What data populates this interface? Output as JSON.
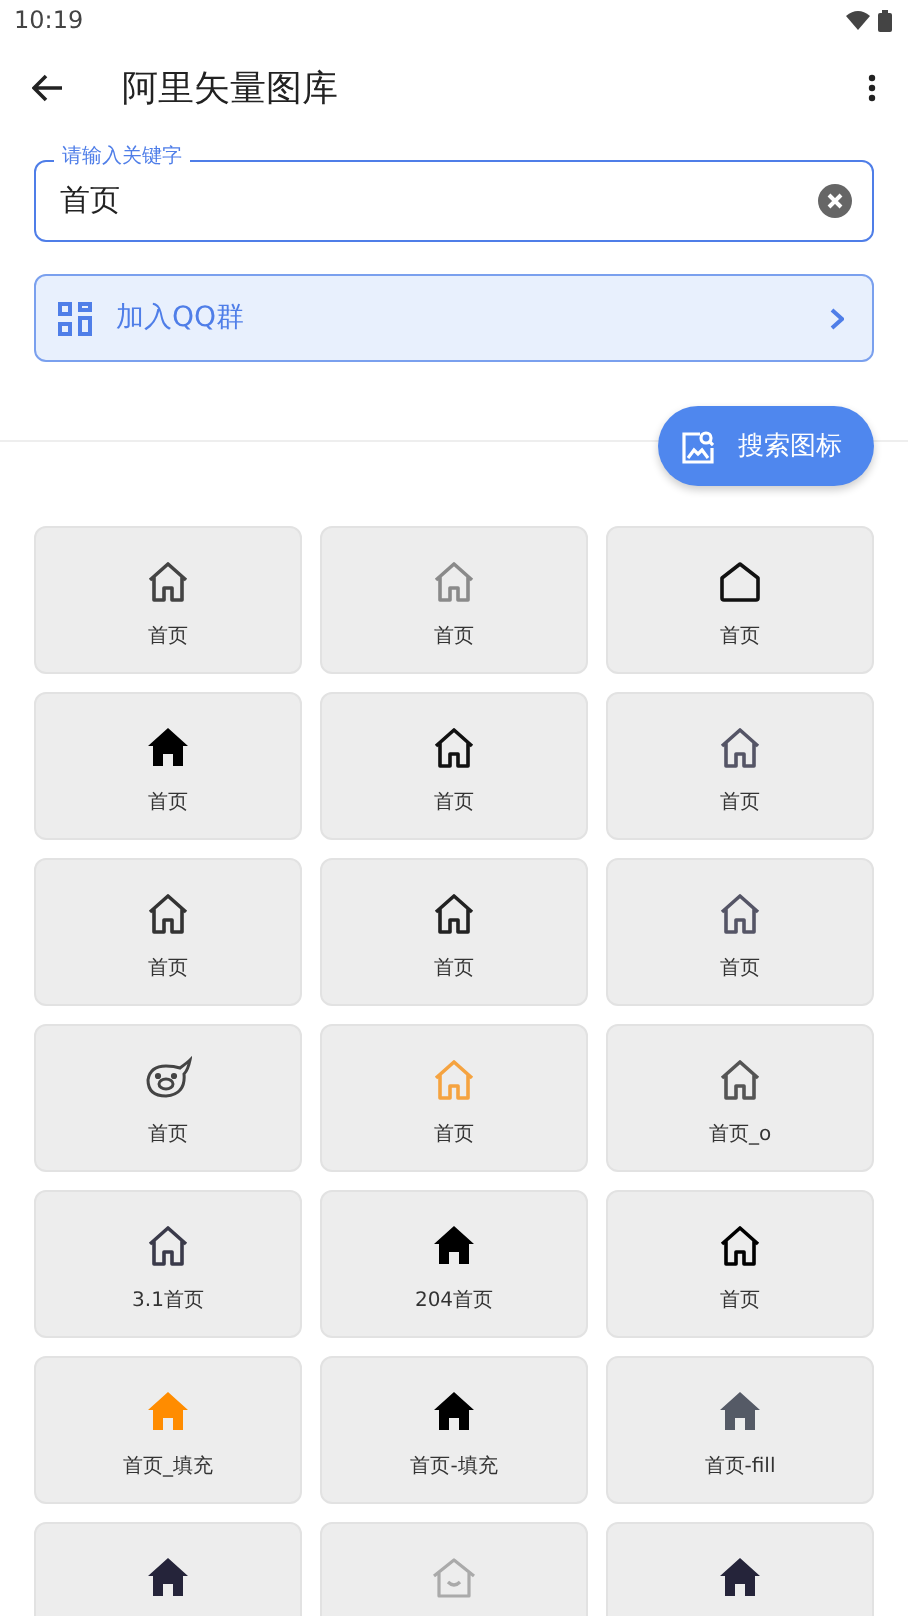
{
  "status_bar": {
    "time": "10:19"
  },
  "app_bar": {
    "title": "阿里矢量图库"
  },
  "search": {
    "label": "请输入关键字",
    "value": "首页"
  },
  "qq_banner": {
    "label": "加入QQ群"
  },
  "fab": {
    "label": "搜索图标"
  },
  "icons": [
    {
      "label": "首页",
      "kind": "outline",
      "color": "#444444"
    },
    {
      "label": "首页",
      "kind": "outline",
      "color": "#8a8a8a"
    },
    {
      "label": "首页",
      "kind": "pentagon",
      "color": "#111111"
    },
    {
      "label": "首页",
      "kind": "filled",
      "color": "#000000"
    },
    {
      "label": "首页",
      "kind": "outline",
      "color": "#111111"
    },
    {
      "label": "首页",
      "kind": "outline",
      "color": "#555566"
    },
    {
      "label": "首页",
      "kind": "outline",
      "color": "#333333"
    },
    {
      "label": "首页",
      "kind": "outline",
      "color": "#222222"
    },
    {
      "label": "首页",
      "kind": "outline",
      "color": "#555566"
    },
    {
      "label": "首页",
      "kind": "pig",
      "color": "#444444"
    },
    {
      "label": "首页",
      "kind": "outline",
      "color": "#f5a340"
    },
    {
      "label": "首页_o",
      "kind": "outline",
      "color": "#555555"
    },
    {
      "label": "3.1首页",
      "kind": "outline",
      "color": "#3a3a4a"
    },
    {
      "label": "204首页",
      "kind": "filled",
      "color": "#000000"
    },
    {
      "label": "首页",
      "kind": "outline",
      "color": "#000000"
    },
    {
      "label": "首页_填充",
      "kind": "filled",
      "color": "#ff8c00"
    },
    {
      "label": "首页-填充",
      "kind": "filled",
      "color": "#000000"
    },
    {
      "label": "首页-fill",
      "kind": "filled",
      "color": "#555a66"
    },
    {
      "kind": "filled",
      "color": "#25243a"
    },
    {
      "kind": "smile",
      "color": "#aaaaaa"
    },
    {
      "kind": "filled",
      "color": "#25243a"
    }
  ]
}
